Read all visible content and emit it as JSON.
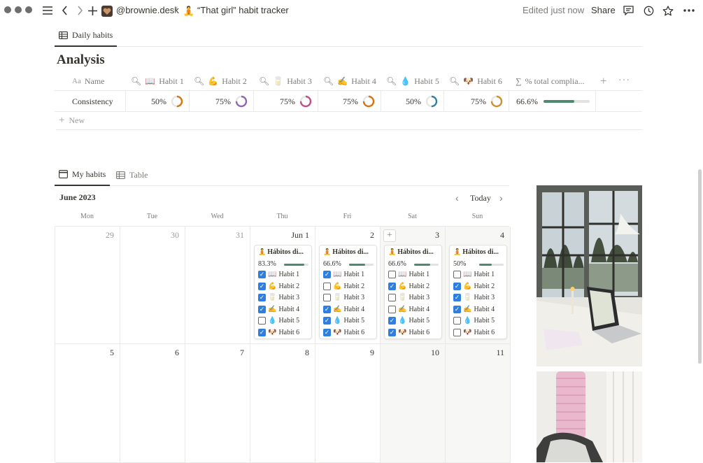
{
  "topbar": {
    "workspace": "@brownie.desk",
    "separator": "/",
    "page_title": "“That girl” habit tracker",
    "edited": "Edited just now",
    "share": "Share"
  },
  "analysis": {
    "tab_label": "Daily habits",
    "title": "Analysis",
    "columns": [
      {
        "name": "Name",
        "icon": "Aa"
      },
      {
        "name": "Habit 1",
        "icon": "📖"
      },
      {
        "name": "Habit 2",
        "icon": "💪"
      },
      {
        "name": "Habit 3",
        "icon": "🥛"
      },
      {
        "name": "Habit 4",
        "icon": "✍️"
      },
      {
        "name": "Habit 5",
        "icon": "💧"
      },
      {
        "name": "Habit 6",
        "icon": "🐶"
      },
      {
        "name": "% total complia...",
        "icon": "∑"
      }
    ],
    "row": {
      "name": "Consistency",
      "values": [
        "50%",
        "75%",
        "75%",
        "75%",
        "50%",
        "75%"
      ],
      "fractions": [
        0.5,
        0.75,
        0.75,
        0.75,
        0.5,
        0.75
      ],
      "ring_colors": [
        "#d9730d",
        "#9065b0",
        "#c14c8a",
        "#d9730d",
        "#337ea9",
        "#cb912f"
      ],
      "total": "66.6%",
      "total_fraction": 0.666
    },
    "new_label": "New"
  },
  "calendar": {
    "tabs": [
      "My habits",
      "Table"
    ],
    "month": "June 2023",
    "today": "Today",
    "weekdays": [
      "Mon",
      "Tue",
      "Wed",
      "Thu",
      "Fri",
      "Sat",
      "Sun"
    ],
    "week1": [
      "29",
      "30",
      "31",
      "Jun 1",
      "2",
      "3",
      "4"
    ],
    "week2": [
      "5",
      "6",
      "7",
      "8",
      "9",
      "10",
      "11"
    ],
    "habit_labels": [
      "Habit 1",
      "Habit 2",
      "Habit 3",
      "Habit 4",
      "Habit 5",
      "Habit 6"
    ],
    "habit_icons": [
      "📖",
      "💪",
      "🥛",
      "✍️",
      "💧",
      "🐶"
    ],
    "cards": [
      {
        "title": "Hábitos di...",
        "pct": "83.3%",
        "fraction": 0.833,
        "checks": [
          true,
          true,
          true,
          true,
          false,
          true
        ]
      },
      {
        "title": "Hábitos di...",
        "pct": "66.6%",
        "fraction": 0.666,
        "checks": [
          true,
          false,
          false,
          true,
          true,
          true
        ]
      },
      {
        "title": "Hábitos di...",
        "pct": "66.6%",
        "fraction": 0.666,
        "checks": [
          false,
          true,
          false,
          false,
          true,
          true
        ]
      },
      {
        "title": "Hábitos di...",
        "pct": "50%",
        "fraction": 0.5,
        "checks": [
          false,
          true,
          true,
          true,
          false,
          false
        ]
      }
    ],
    "card_icon": "🧘"
  },
  "colors": {
    "accent_check": "#2f7fe0",
    "progress_green": "#4f8a6f"
  }
}
